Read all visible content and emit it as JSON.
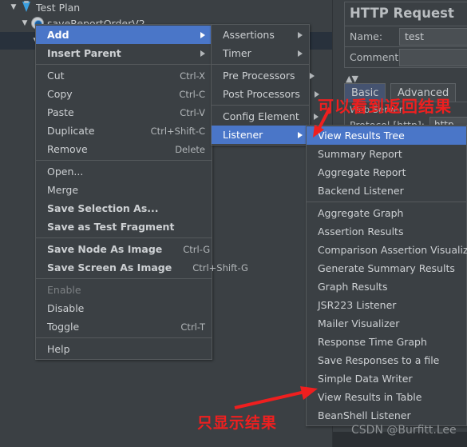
{
  "tree": {
    "rows": [
      {
        "label": "Test Plan",
        "icon": "flask-icon",
        "indent": 10,
        "toggle": "▼",
        "selected": false
      },
      {
        "label": "saveReportOrderV2",
        "icon": "gear-icon",
        "indent": 24,
        "toggle": "▼",
        "selected": false
      },
      {
        "label": "",
        "icon": "pencil-icon",
        "indent": 38,
        "toggle": "▼",
        "selected": true
      },
      {
        "label": "",
        "icon": "pencil-grey-icon",
        "indent": 38,
        "toggle": "",
        "selected": false
      },
      {
        "label": "",
        "icon": "pink-leaf-icon",
        "indent": 38,
        "toggle": "",
        "selected": false
      },
      {
        "label": "",
        "icon": "pink-leaf-icon",
        "indent": 38,
        "toggle": "",
        "selected": false
      }
    ]
  },
  "context_menu": {
    "items": [
      {
        "label": "Add",
        "accel": "",
        "submenu": true,
        "selected": true,
        "bold": true,
        "disabled": false,
        "sep_after": false
      },
      {
        "label": "Insert Parent",
        "accel": "",
        "submenu": true,
        "selected": false,
        "bold": true,
        "disabled": false,
        "sep_after": true
      },
      {
        "label": "Cut",
        "accel": "Ctrl-X",
        "submenu": false,
        "selected": false,
        "bold": false,
        "disabled": false,
        "sep_after": false
      },
      {
        "label": "Copy",
        "accel": "Ctrl-C",
        "submenu": false,
        "selected": false,
        "bold": false,
        "disabled": false,
        "sep_after": false
      },
      {
        "label": "Paste",
        "accel": "Ctrl-V",
        "submenu": false,
        "selected": false,
        "bold": false,
        "disabled": false,
        "sep_after": false
      },
      {
        "label": "Duplicate",
        "accel": "Ctrl+Shift-C",
        "submenu": false,
        "selected": false,
        "bold": false,
        "disabled": false,
        "sep_after": false
      },
      {
        "label": "Remove",
        "accel": "Delete",
        "submenu": false,
        "selected": false,
        "bold": false,
        "disabled": false,
        "sep_after": true
      },
      {
        "label": "Open...",
        "accel": "",
        "submenu": false,
        "selected": false,
        "bold": false,
        "disabled": false,
        "sep_after": false
      },
      {
        "label": "Merge",
        "accel": "",
        "submenu": false,
        "selected": false,
        "bold": false,
        "disabled": false,
        "sep_after": false
      },
      {
        "label": "Save Selection As...",
        "accel": "",
        "submenu": false,
        "selected": false,
        "bold": true,
        "disabled": false,
        "sep_after": false
      },
      {
        "label": "Save as Test Fragment",
        "accel": "",
        "submenu": false,
        "selected": false,
        "bold": true,
        "disabled": false,
        "sep_after": true
      },
      {
        "label": "Save Node As Image",
        "accel": "Ctrl-G",
        "submenu": false,
        "selected": false,
        "bold": true,
        "disabled": false,
        "sep_after": false
      },
      {
        "label": "Save Screen As Image",
        "accel": "Ctrl+Shift-G",
        "submenu": false,
        "selected": false,
        "bold": true,
        "disabled": false,
        "sep_after": true
      },
      {
        "label": "Enable",
        "accel": "",
        "submenu": false,
        "selected": false,
        "bold": false,
        "disabled": true,
        "sep_after": false
      },
      {
        "label": "Disable",
        "accel": "",
        "submenu": false,
        "selected": false,
        "bold": false,
        "disabled": false,
        "sep_after": false
      },
      {
        "label": "Toggle",
        "accel": "Ctrl-T",
        "submenu": false,
        "selected": false,
        "bold": false,
        "disabled": false,
        "sep_after": true
      },
      {
        "label": "Help",
        "accel": "",
        "submenu": false,
        "selected": false,
        "bold": false,
        "disabled": false,
        "sep_after": false
      }
    ]
  },
  "add_submenu": {
    "items": [
      {
        "label": "Assertions",
        "submenu": true,
        "selected": false,
        "sep_after": false
      },
      {
        "label": "Timer",
        "submenu": true,
        "selected": false,
        "sep_after": true
      },
      {
        "label": "Pre Processors",
        "submenu": true,
        "selected": false,
        "sep_after": false
      },
      {
        "label": "Post Processors",
        "submenu": true,
        "selected": false,
        "sep_after": true
      },
      {
        "label": "Config Element",
        "submenu": true,
        "selected": false,
        "sep_after": false
      },
      {
        "label": "Listener",
        "submenu": true,
        "selected": true,
        "sep_after": false
      }
    ]
  },
  "listener_submenu": {
    "items": [
      {
        "label": "View Results Tree",
        "selected": true,
        "sep_after": false
      },
      {
        "label": "Summary Report",
        "selected": false,
        "sep_after": false
      },
      {
        "label": "Aggregate Report",
        "selected": false,
        "sep_after": false
      },
      {
        "label": "Backend Listener",
        "selected": false,
        "sep_after": true
      },
      {
        "label": "Aggregate Graph",
        "selected": false,
        "sep_after": false
      },
      {
        "label": "Assertion Results",
        "selected": false,
        "sep_after": false
      },
      {
        "label": "Comparison Assertion Visualizer",
        "selected": false,
        "sep_after": false
      },
      {
        "label": "Generate Summary Results",
        "selected": false,
        "sep_after": false
      },
      {
        "label": "Graph Results",
        "selected": false,
        "sep_after": false
      },
      {
        "label": "JSR223 Listener",
        "selected": false,
        "sep_after": false
      },
      {
        "label": "Mailer Visualizer",
        "selected": false,
        "sep_after": false
      },
      {
        "label": "Response Time Graph",
        "selected": false,
        "sep_after": false
      },
      {
        "label": "Save Responses to a file",
        "selected": false,
        "sep_after": false
      },
      {
        "label": "Simple Data Writer",
        "selected": false,
        "sep_after": false
      },
      {
        "label": "View Results in Table",
        "selected": false,
        "sep_after": false
      },
      {
        "label": "BeanShell Listener",
        "selected": false,
        "sep_after": false
      }
    ]
  },
  "properties": {
    "title": "HTTP Request",
    "name_label": "Name:",
    "name_value": "test",
    "comments_label": "Comments:",
    "comments_value": "",
    "tabs": [
      {
        "label": "Basic",
        "active": true
      },
      {
        "label": "Advanced",
        "active": false
      }
    ],
    "web_server_legend": "Web Server",
    "protocol_label": "Protocol [http]:",
    "protocol_value": "http"
  },
  "annotations": [
    {
      "id": "anno-top",
      "text": "可以看到返回结果",
      "color": "#ef1f1f"
    },
    {
      "id": "anno-bottom",
      "text": "只显示结果",
      "color": "#ef1f1f"
    }
  ],
  "watermark": {
    "text": "CSDN @Burfitt.Lee"
  }
}
